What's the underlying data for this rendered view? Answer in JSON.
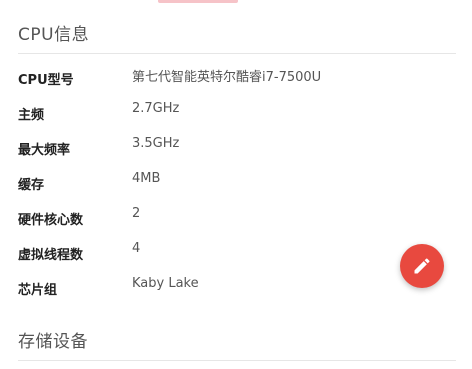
{
  "cpu_section": {
    "title": "CPU信息"
  },
  "cpu_specs": [
    {
      "label": "CPU型号",
      "value": "第七代智能英特尔酷睿i7-7500U"
    },
    {
      "label": "主频",
      "value": "2.7GHz"
    },
    {
      "label": "最大频率",
      "value": "3.5GHz"
    },
    {
      "label": "缓存",
      "value": "4MB"
    },
    {
      "label": "硬件核心数",
      "value": "2"
    },
    {
      "label": "虚拟线程数",
      "value": "4"
    },
    {
      "label": "芯片组",
      "value": "Kaby Lake"
    }
  ],
  "storage_section": {
    "title": "存储设备"
  },
  "fab": {
    "icon": "pencil-icon",
    "color": "#e8493f"
  }
}
